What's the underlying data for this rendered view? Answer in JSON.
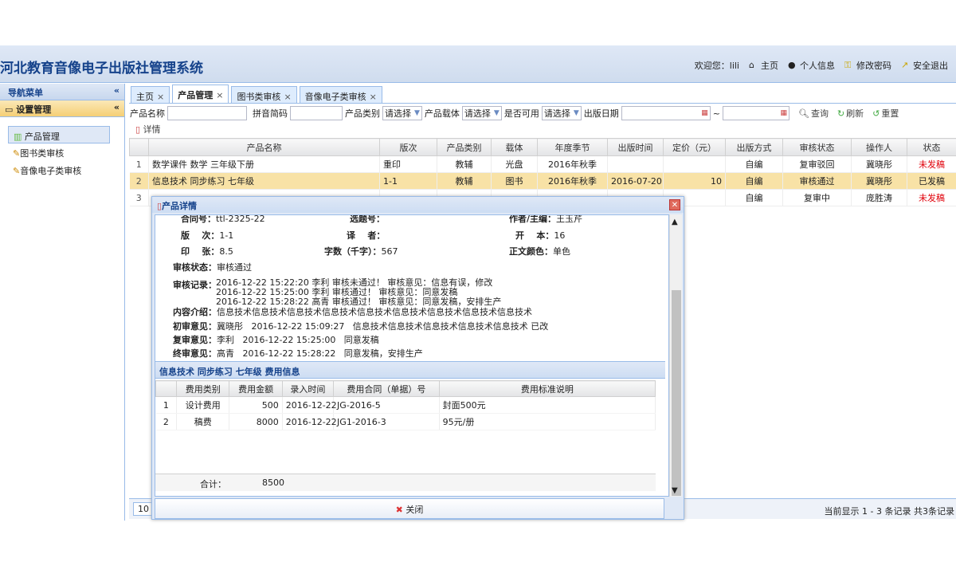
{
  "header": {
    "title": "河北教育音像电子出版社管理系统",
    "welcome": "欢迎您：lili",
    "nav": [
      "主页",
      "个人信息",
      "修改密码",
      "安全退出"
    ]
  },
  "sidebar": {
    "title": "导航菜单",
    "collapse": "«",
    "section": "设置管理",
    "section_toggle": "«",
    "items": [
      "产品管理",
      "图书类审核",
      "音像电子类审核"
    ]
  },
  "tabs": [
    "主页",
    "产品管理",
    "图书类审核",
    "音像电子类审核"
  ],
  "tab_close": "×",
  "filter": {
    "name_label": "产品名称",
    "pinyin_label": "拼音简码",
    "type_label": "产品类别",
    "media_label": "产品载体",
    "available_label": "是否可用",
    "date_label": "出版日期",
    "select_placeholder": "请选择",
    "range_sep": "~",
    "query": "查询",
    "refresh": "刷新",
    "reset": "重置",
    "detail": "详情"
  },
  "grid": {
    "columns": [
      "",
      "产品名称",
      "版次",
      "产品类别",
      "载体",
      "年度季节",
      "出版时间",
      "定价（元）",
      "出版方式",
      "审核状态",
      "操作人",
      "状态"
    ],
    "rows": [
      [
        "1",
        "数学课件 数学 三年级下册",
        "重印",
        "教辅",
        "光盘",
        "2016年秋季",
        "",
        "",
        "自编",
        "复审驳回",
        "冀晓彤",
        "未发稿"
      ],
      [
        "2",
        "信息技术 同步练习 七年级",
        "1-1",
        "教辅",
        "图书",
        "2016年秋季",
        "2016-07-20",
        "10",
        "自编",
        "审核通过",
        "冀晓彤",
        "已发稿"
      ],
      [
        "3",
        "",
        "",
        "",
        "",
        "",
        "",
        "",
        "自编",
        "复审中",
        "庞胜涛",
        "未发稿"
      ]
    ]
  },
  "pager": {
    "page_size": "10",
    "info": "当前显示 1 - 3 条记录 共3条记录"
  },
  "modal": {
    "title": "产品详情",
    "contract_label": "合同号：",
    "contract": "ttl-2325-22",
    "topic_label": "选题号：",
    "author_label": "作者/主编：",
    "author": "王玉芹",
    "edition_label": "版    次：",
    "edition": "1-1",
    "translator_label": "译    者：",
    "format_label": "开    本：",
    "format": "16",
    "sheets_label": "印    张：",
    "sheets": "8.5",
    "words_label": "字数（千字）：",
    "words": "567",
    "color_label": "正文颜色：",
    "color": "单色",
    "status_label": "审核状态：",
    "status": "审核通过",
    "record_label": "审核记录：",
    "records": [
      "2016-12-22 15:22:20 李利 审核未通过！ 审核意见：信息有误，修改",
      "2016-12-22 15:25:00 李利 审核通过！ 审核意见：同意发稿",
      "2016-12-22 15:28:22 高青 审核通过！ 审核意见：同意发稿，安排生产"
    ],
    "intro_label": "内容介绍：",
    "intro": "信息技术信息技术信息技术信息技术信息技术信息技术信息技术信息技术信息技术",
    "first_label": "初审意见：",
    "first": "冀晓彤   2016-12-22 15:09:27   信息技术信息技术信息技术信息技术信息技术 已改",
    "second_label": "复审意见：",
    "second": "李利   2016-12-22 15:25:00   同意发稿",
    "final_label": "终审意见：",
    "final": "高青   2016-12-22 15:28:22   同意发稿，安排生产",
    "fee_title": "信息技术 同步练习 七年级 费用信息",
    "fee_columns": [
      "",
      "费用类别",
      "费用金额",
      "录入时间",
      "费用合同（单据）号",
      "费用标准说明"
    ],
    "fee_rows": [
      [
        "1",
        "设计费用",
        "500",
        "2016-12-22",
        "JG-2016-5",
        "封面500元"
      ],
      [
        "2",
        "稿费",
        "8000",
        "2016-12-22",
        "JG1-2016-3",
        "95元/册"
      ]
    ],
    "sum_label": "合计：",
    "sum": "8500",
    "close": "关闭"
  }
}
